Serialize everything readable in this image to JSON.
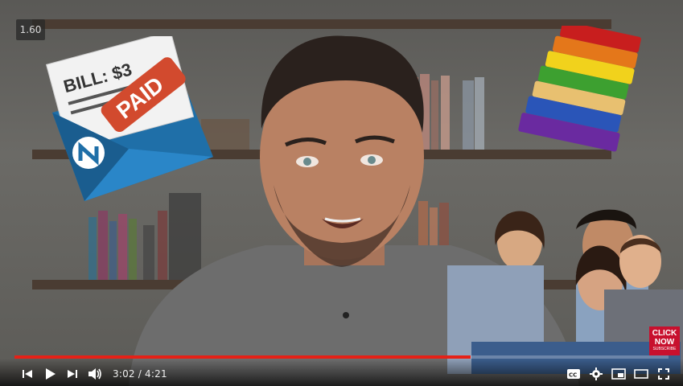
{
  "player": {
    "speed_badge": "1.60",
    "time_current": "3:02",
    "time_separator": " / ",
    "time_total": "4:21",
    "progress_fraction": 0.697,
    "accent_color": "#e62117"
  },
  "overlays": {
    "bill_text": "BILL: $3",
    "paid_stamp": "PAID",
    "cta_line1": "CLICK",
    "cta_line2": "NOW",
    "cta_line3": "SUBSCRIBE"
  },
  "controls": {
    "left": [
      "skip-back-icon",
      "play-icon",
      "next-icon",
      "volume-icon"
    ],
    "right": [
      "captions-icon",
      "settings-icon",
      "miniplayer-icon",
      "theater-icon",
      "fullscreen-icon"
    ]
  }
}
